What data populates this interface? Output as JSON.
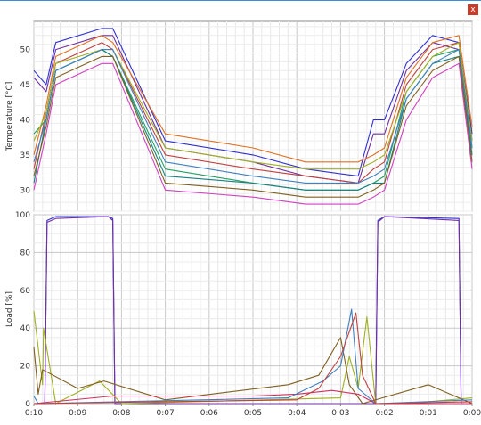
{
  "window": {
    "close_label": "x"
  },
  "chart_data": [
    {
      "type": "line",
      "ylabel": "Temperature [°C]",
      "xlabel": "",
      "ylim": [
        27,
        54
      ],
      "yticks": [
        30,
        35,
        40,
        45,
        50
      ],
      "x_tick_labels": [
        "0:10",
        "0:09",
        "0:08",
        "0:07",
        "0:06",
        "0:05",
        "0:04",
        "0:03",
        "0:02",
        "0:01",
        "0:00"
      ],
      "x_minutes_remaining": [
        10.0,
        9.72,
        9.5,
        8.45,
        8.2,
        7.0,
        5.0,
        3.8,
        2.6,
        2.25,
        2.0,
        1.5,
        0.9,
        0.3,
        0.0
      ],
      "grid": true,
      "series": [
        {
          "color": "#3030d0",
          "values": [
            47,
            45,
            51,
            53,
            53,
            37,
            35,
            33,
            32,
            40,
            40,
            48,
            52,
            51,
            38
          ]
        },
        {
          "color": "#7030a0",
          "values": [
            46,
            44,
            50,
            52,
            52,
            36,
            34,
            32,
            31,
            38,
            38,
            47,
            51,
            50,
            37
          ]
        },
        {
          "color": "#e07020",
          "values": [
            35,
            42,
            49,
            52,
            51,
            38,
            36,
            34,
            34,
            35,
            36,
            46,
            51,
            52,
            39
          ]
        },
        {
          "color": "#c04040",
          "values": [
            33,
            41,
            48,
            51,
            50,
            35,
            33,
            32,
            31,
            33,
            34,
            45,
            50,
            51,
            37
          ]
        },
        {
          "color": "#20a060",
          "values": [
            38,
            40,
            47,
            50,
            49,
            33,
            31,
            30,
            30,
            31,
            32,
            44,
            49,
            50,
            36
          ]
        },
        {
          "color": "#1a8080",
          "values": [
            31,
            40,
            47,
            50,
            49,
            32,
            31,
            30,
            30,
            31,
            31,
            43,
            48,
            49,
            35
          ]
        },
        {
          "color": "#a0b020",
          "values": [
            37,
            41,
            48,
            50,
            50,
            36,
            34,
            33,
            33,
            34,
            35,
            44,
            49,
            51,
            37
          ]
        },
        {
          "color": "#d040c0",
          "values": [
            30,
            38,
            45,
            48,
            48,
            30,
            29,
            28,
            28,
            29,
            30,
            40,
            46,
            48,
            33
          ]
        },
        {
          "color": "#806020",
          "values": [
            32,
            39,
            46,
            49,
            49,
            31,
            30,
            29,
            29,
            30,
            31,
            42,
            47,
            49,
            34
          ]
        },
        {
          "color": "#4080c0",
          "values": [
            34,
            40,
            47,
            50,
            50,
            34,
            32,
            31,
            31,
            32,
            33,
            43,
            48,
            50,
            36
          ]
        }
      ]
    },
    {
      "type": "line",
      "ylabel": "Load [%]",
      "xlabel": "",
      "ylim": [
        0,
        100
      ],
      "yticks": [
        0,
        20,
        40,
        60,
        80,
        100
      ],
      "x_tick_labels": [
        "0:10",
        "0:09",
        "0:08",
        "0:07",
        "0:06",
        "0:05",
        "0:04",
        "0:03",
        "0:02",
        "0:01",
        "0:00"
      ],
      "grid": true,
      "series": [
        {
          "color": "#3030d0",
          "x_minutes_remaining": [
            10.0,
            9.75,
            9.7,
            9.5,
            8.3,
            8.2,
            8.15,
            2.2,
            2.15,
            2.0,
            0.3,
            0.25,
            0.0
          ],
          "values": [
            0,
            0,
            97,
            99,
            99,
            98,
            0,
            0,
            97,
            99,
            98,
            0,
            0
          ]
        },
        {
          "color": "#7030a0",
          "x_minutes_remaining": [
            10.0,
            9.75,
            9.7,
            9.5,
            8.3,
            8.2,
            8.15,
            2.2,
            2.15,
            2.0,
            0.3,
            0.25,
            0.0
          ],
          "values": [
            0,
            0,
            96,
            98,
            99,
            97,
            0,
            0,
            96,
            99,
            97,
            0,
            0
          ]
        },
        {
          "color": "#a0b020",
          "x_minutes_remaining": [
            10.0,
            9.8,
            9.78,
            9.5,
            8.5,
            8.0,
            3.0,
            2.8,
            2.6,
            2.4,
            2.2,
            1.5,
            0.0
          ],
          "values": [
            49,
            10,
            40,
            0,
            12,
            0,
            3,
            25,
            8,
            46,
            0,
            0,
            3
          ]
        },
        {
          "color": "#806020",
          "x_minutes_remaining": [
            10.0,
            9.9,
            9.8,
            9.0,
            8.4,
            7.0,
            4.2,
            3.5,
            3.0,
            2.8,
            2.5,
            1.0,
            0.0
          ],
          "values": [
            30,
            5,
            18,
            8,
            12,
            2,
            10,
            15,
            35,
            10,
            0,
            10,
            0
          ]
        },
        {
          "color": "#d03060",
          "x_minutes_remaining": [
            10.0,
            8.2,
            7.0,
            5.0,
            4.0,
            3.2,
            2.6,
            2.2,
            0.0
          ],
          "values": [
            0,
            4,
            4,
            4,
            5,
            7,
            5,
            0,
            0
          ]
        },
        {
          "color": "#4080c0",
          "x_minutes_remaining": [
            10.0,
            9.9,
            4.2,
            3.4,
            3.0,
            2.75,
            2.6,
            2.2,
            0.0
          ],
          "values": [
            4,
            0,
            3,
            12,
            20,
            50,
            8,
            0,
            2
          ]
        },
        {
          "color": "#c04040",
          "x_minutes_remaining": [
            10.0,
            4.0,
            3.5,
            3.0,
            2.65,
            2.5,
            2.2,
            0.0
          ],
          "values": [
            0,
            2,
            8,
            25,
            48,
            15,
            0,
            1
          ]
        }
      ]
    }
  ]
}
